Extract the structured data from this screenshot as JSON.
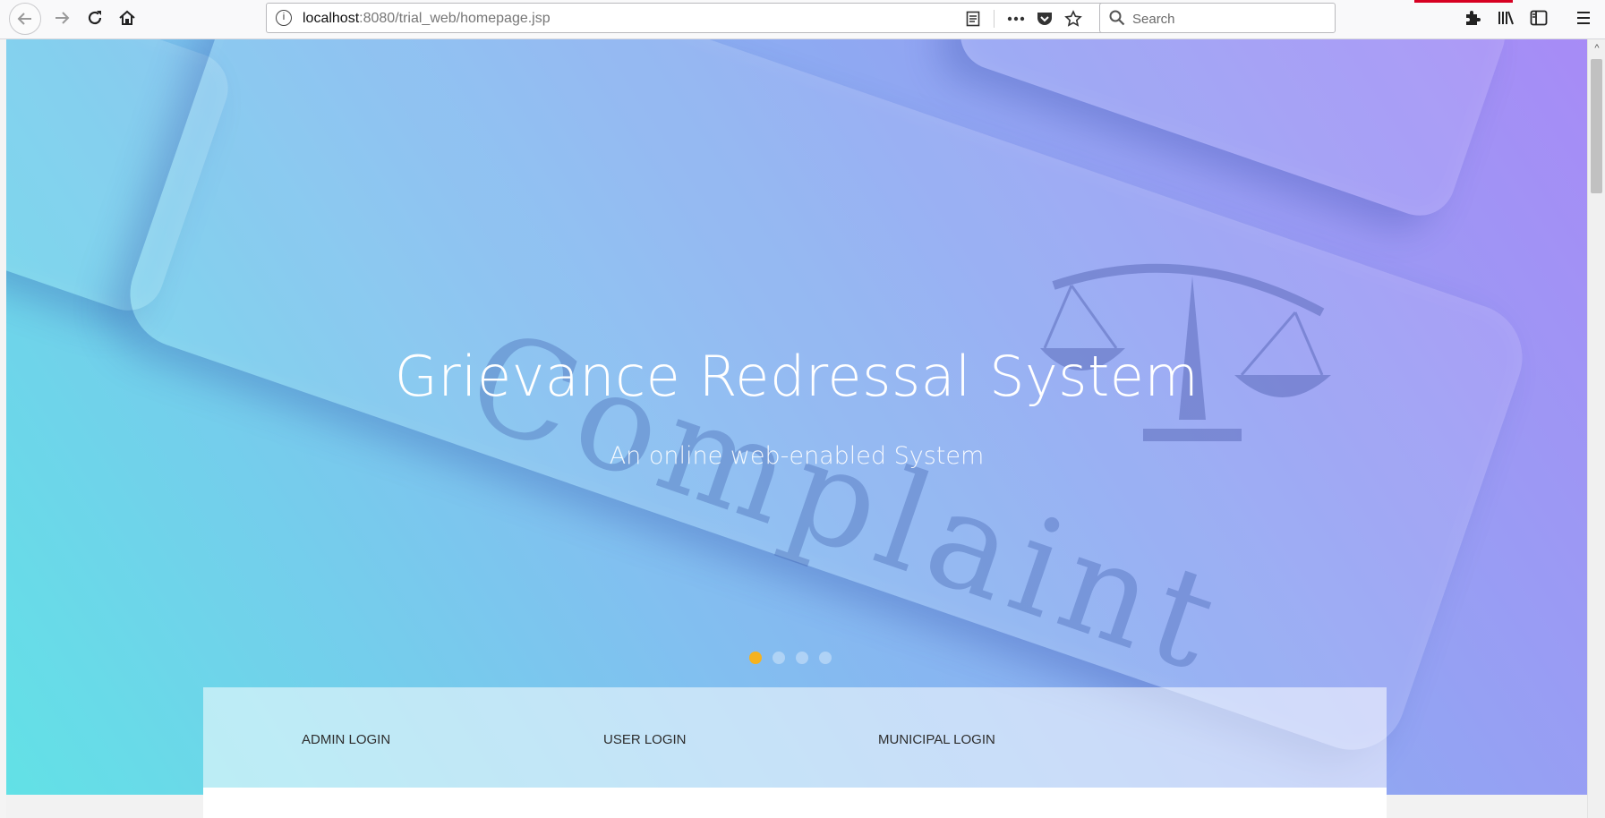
{
  "browser": {
    "url": {
      "host": "localhost",
      "path": ":8080/trial_web/homepage.jsp"
    },
    "search_placeholder": "Search",
    "icons": [
      "back-arrow-icon",
      "forward-arrow-icon",
      "reload-icon",
      "home-icon",
      "info-icon",
      "reader-view-icon",
      "more-actions-icon",
      "pocket-icon",
      "bookmark-star-icon",
      "search-icon",
      "extensions-icon",
      "library-icon",
      "sidebar-icon",
      "hamburger-menu-icon"
    ],
    "accent_color": "#d70022"
  },
  "hero": {
    "title": "Grievance Redressal System",
    "subtitle": "An online web-enabled System",
    "slide_count": 4,
    "active_slide": 1,
    "active_dot_color": "#f5b21f"
  },
  "login": {
    "admin": "ADMIN LOGIN",
    "user": "USER LOGIN",
    "municipal": "MUNICIPAL LOGIN"
  }
}
